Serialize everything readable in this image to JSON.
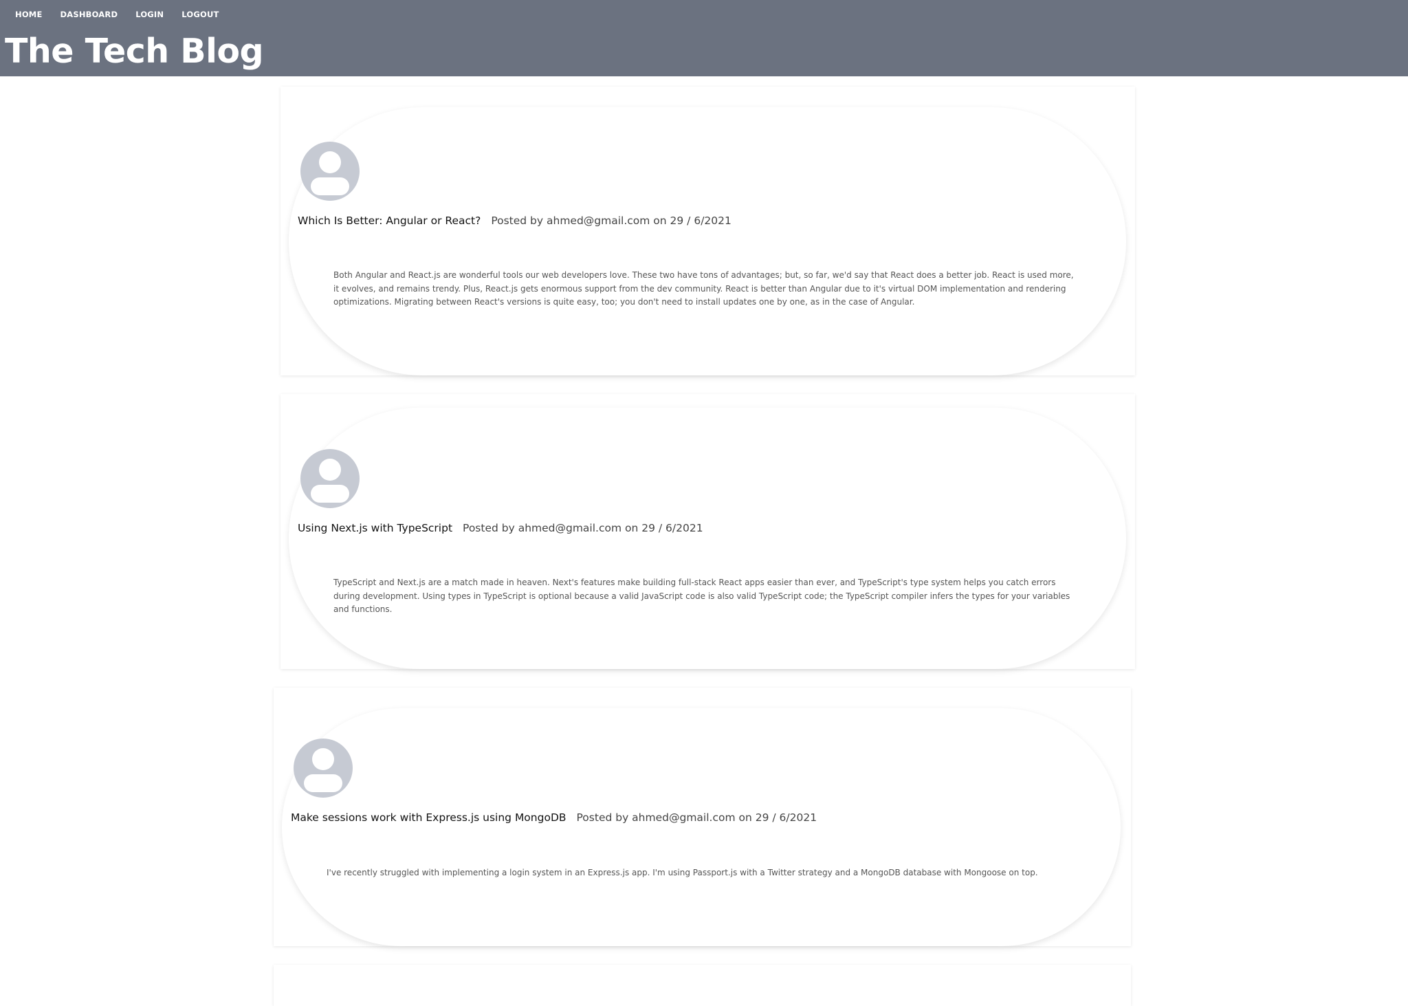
{
  "nav": {
    "items": [
      "HOME",
      "DASHBOARD",
      "LOGIN",
      "LOGOUT"
    ]
  },
  "site_title": "The Tech Blog",
  "posts": [
    {
      "title": "Which Is Better: Angular or React?",
      "meta": "Posted by ahmed@gmail.com on 29 / 6/2021",
      "content": "Both Angular and React.js are wonderful tools our web developers love. These two have tons of advantages; but, so far, we'd say that React does a better job. React is used more, it evolves, and remains trendy. Plus, React.js gets enormous support from the dev community. React is better than Angular due to it's virtual DOM implementation and rendering optimizations. Migrating between React's versions is quite easy, too; you don't need to install updates one by one, as in the case of Angular."
    },
    {
      "title": "Using Next.js with TypeScript",
      "meta": "Posted by ahmed@gmail.com on 29 / 6/2021",
      "content": "TypeScript and Next.js are a match made in heaven. Next's features make building full-stack React apps easier than ever, and TypeScript's type system helps you catch errors during development. Using types in TypeScript is optional because a valid JavaScript code is also valid TypeScript code; the TypeScript compiler infers the types for your variables and functions."
    },
    {
      "title": "Make sessions work with Express.js using MongoDB",
      "meta": "Posted by ahmed@gmail.com on 29 / 6/2021",
      "content": "I've recently struggled with implementing a login system in an Express.js app. I'm using Passport.js with a Twitter strategy and a MongoDB database with Mongoose on top."
    }
  ],
  "colors": {
    "header_bg": "#6b7280",
    "header_text": "#ffffff",
    "avatar_bg": "#c6cad3"
  },
  "icons": {
    "avatar": "user-avatar-icon"
  }
}
